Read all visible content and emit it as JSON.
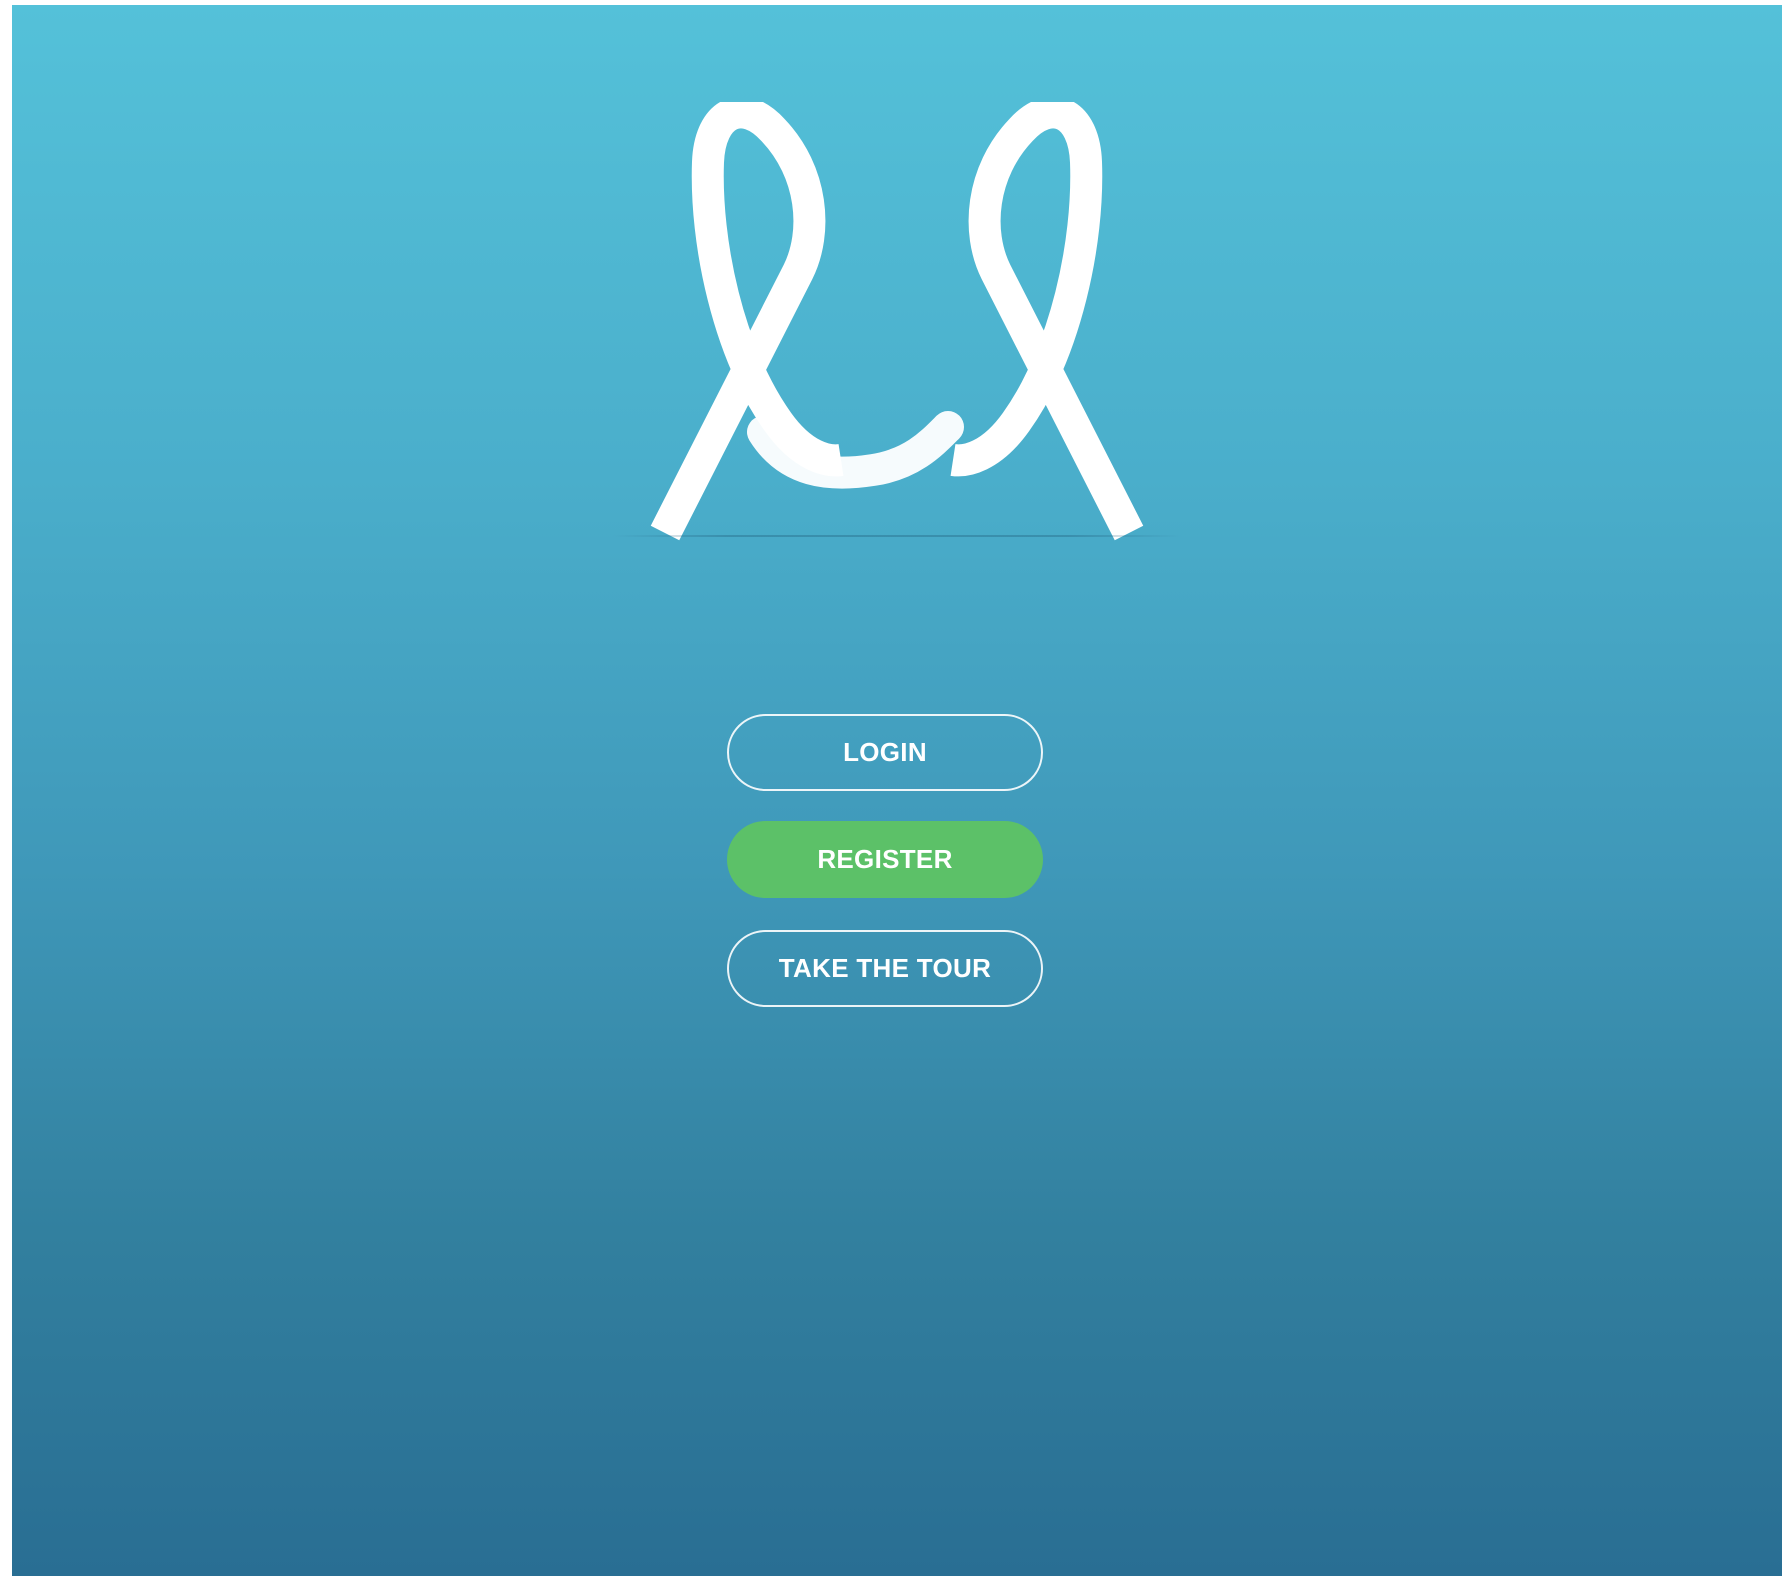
{
  "logo": {
    "icon": "bunny-ears-logo-icon",
    "color": "#ffffff"
  },
  "buttons": {
    "login_label": "LOGIN",
    "register_label": "REGISTER",
    "tour_label": "TAKE THE TOUR"
  },
  "colors": {
    "background_top": "#54c1d9",
    "background_bottom": "#296e93",
    "register_green": "#5cc168",
    "text": "#ffffff"
  }
}
